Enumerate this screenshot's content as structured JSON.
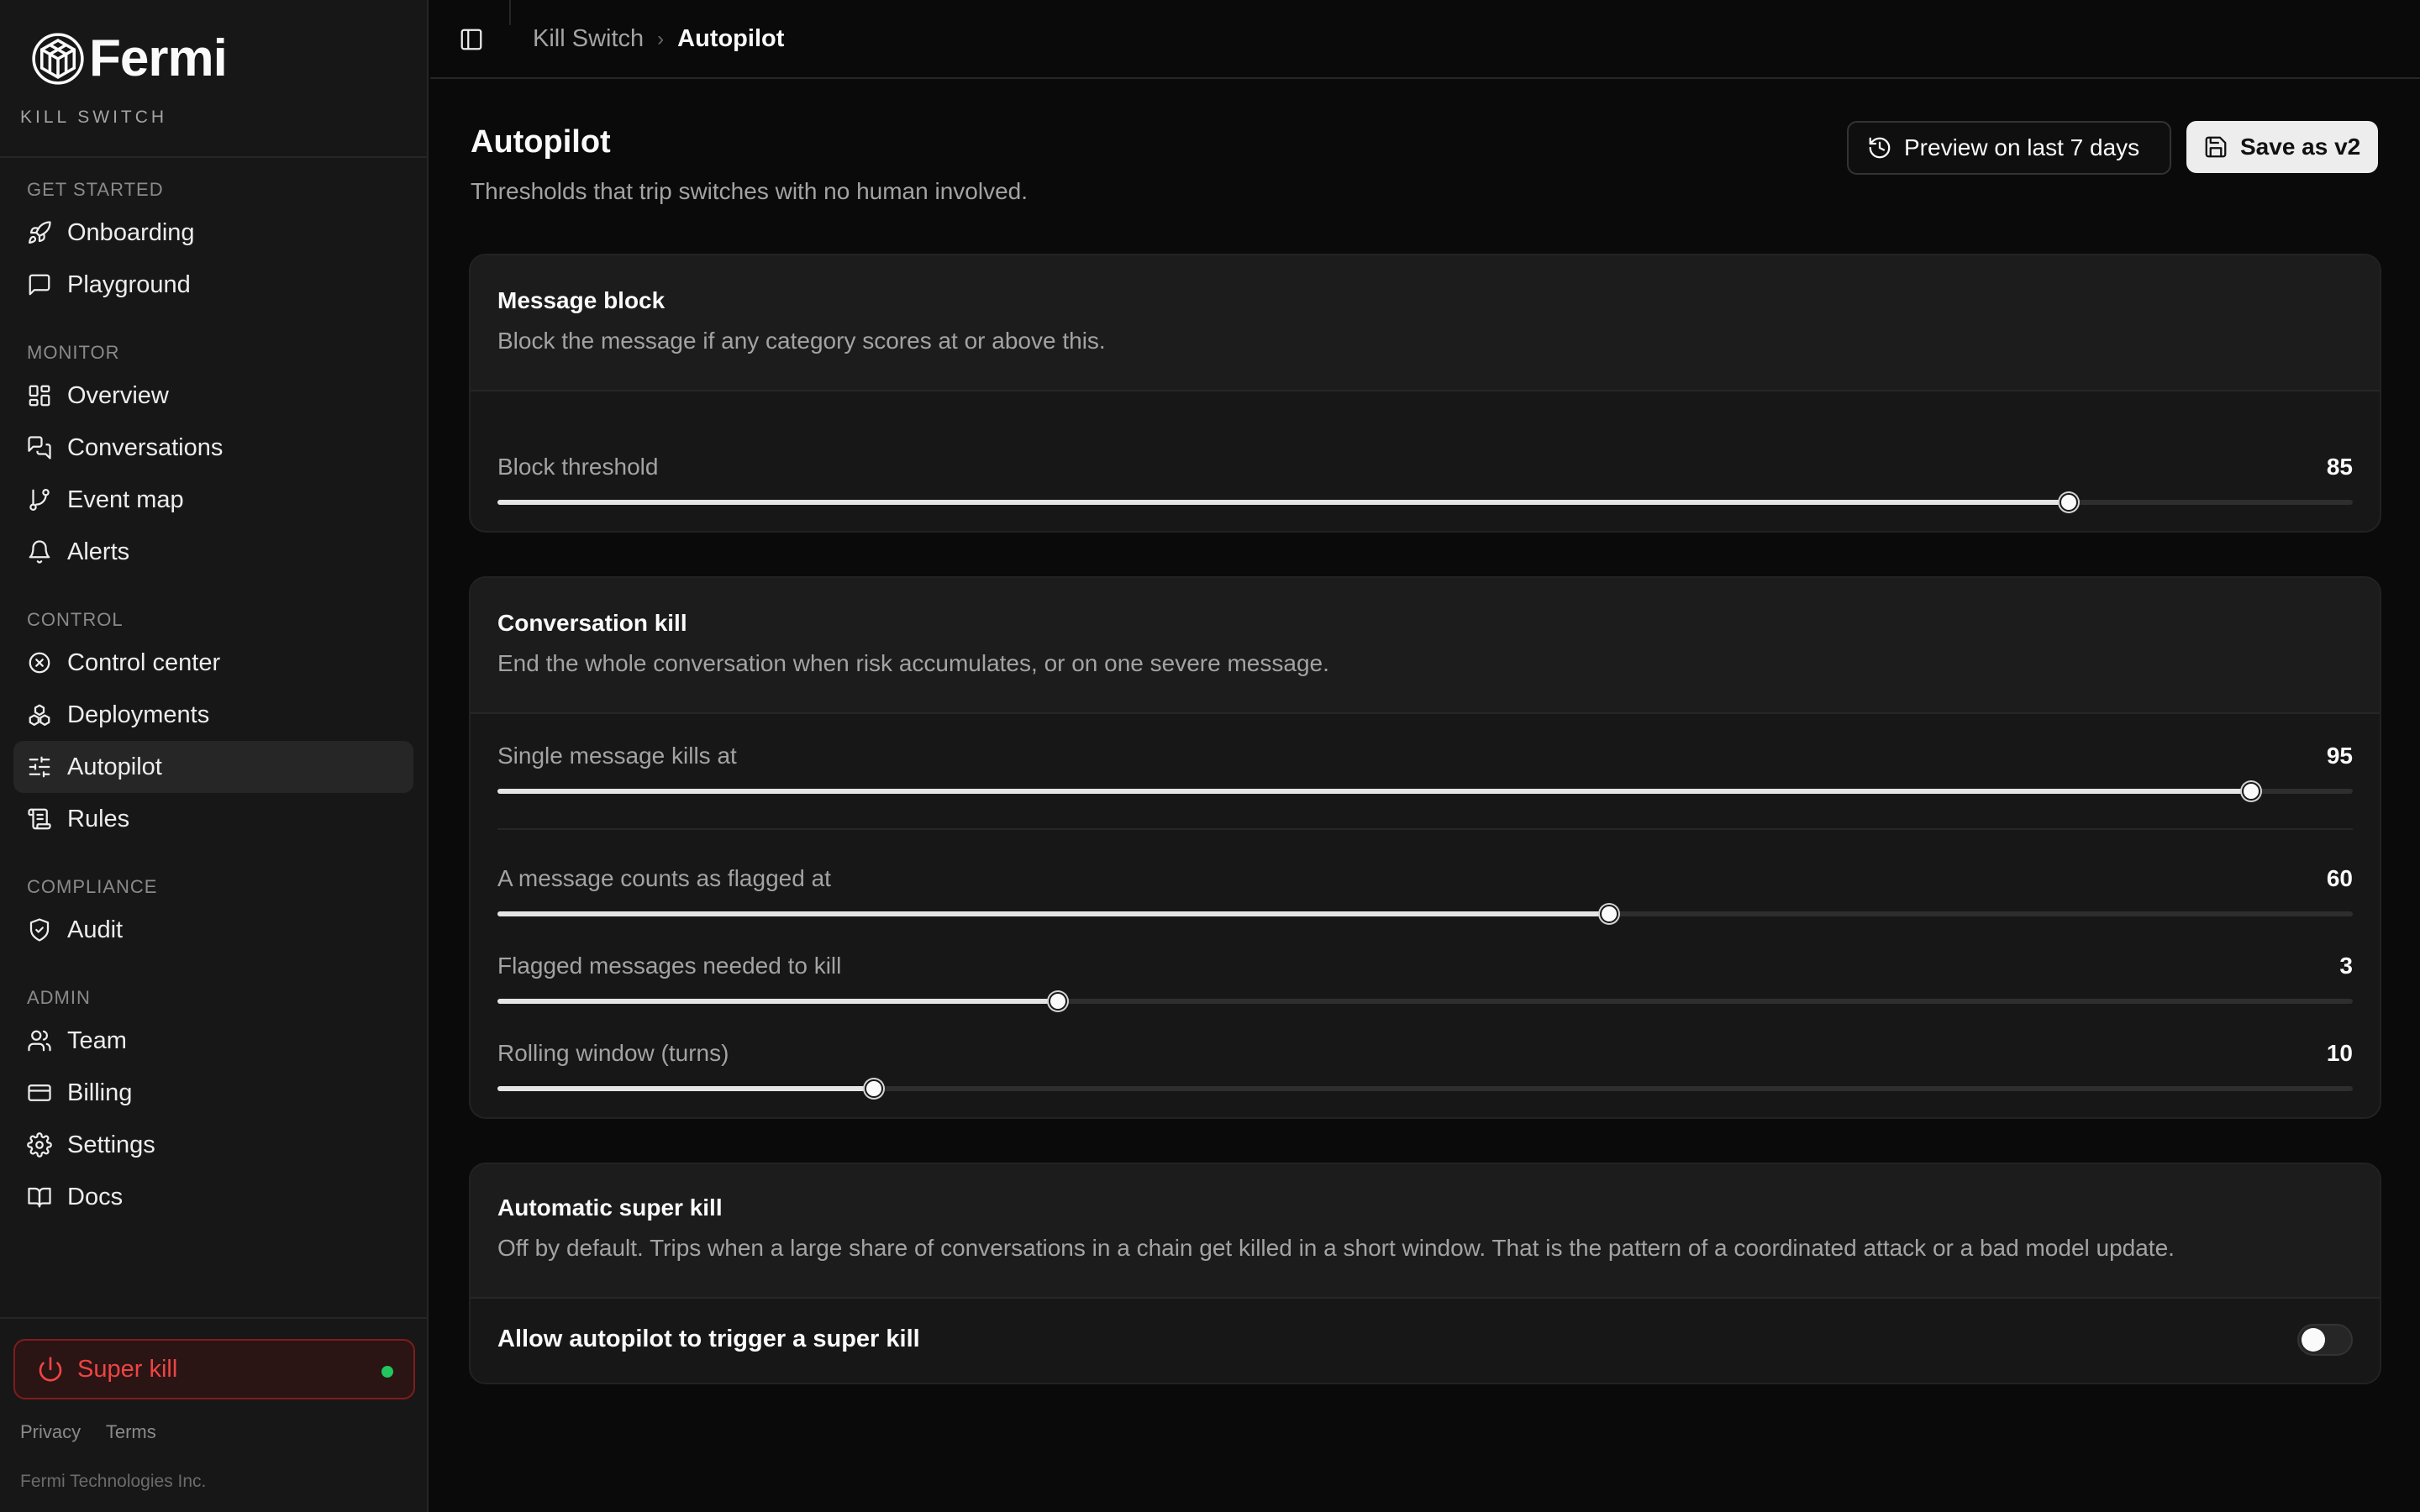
{
  "brand": {
    "name": "Fermi",
    "subtitle": "KILL SWITCH"
  },
  "sidebar": {
    "groups": [
      {
        "label": "GET STARTED",
        "items": [
          {
            "label": "Onboarding",
            "icon": "rocket-icon"
          },
          {
            "label": "Playground",
            "icon": "message-square-icon"
          }
        ]
      },
      {
        "label": "MONITOR",
        "items": [
          {
            "label": "Overview",
            "icon": "dashboard-grid-icon"
          },
          {
            "label": "Conversations",
            "icon": "messages-icon"
          },
          {
            "label": "Event map",
            "icon": "git-branch-icon"
          },
          {
            "label": "Alerts",
            "icon": "bell-icon"
          }
        ]
      },
      {
        "label": "CONTROL",
        "items": [
          {
            "label": "Control center",
            "icon": "circle-x-icon"
          },
          {
            "label": "Deployments",
            "icon": "boxes-icon"
          },
          {
            "label": "Autopilot",
            "icon": "sliders-icon",
            "active": true
          },
          {
            "label": "Rules",
            "icon": "scroll-icon"
          }
        ]
      },
      {
        "label": "COMPLIANCE",
        "items": [
          {
            "label": "Audit",
            "icon": "shield-check-icon"
          }
        ]
      },
      {
        "label": "ADMIN",
        "items": [
          {
            "label": "Team",
            "icon": "users-icon"
          },
          {
            "label": "Billing",
            "icon": "credit-card-icon"
          },
          {
            "label": "Settings",
            "icon": "gear-icon"
          },
          {
            "label": "Docs",
            "icon": "book-open-icon"
          }
        ]
      }
    ],
    "super_kill": {
      "label": "Super kill",
      "status_color": "#22c55e"
    },
    "footer": {
      "privacy": "Privacy",
      "terms": "Terms",
      "copyright": "Fermi Technologies Inc."
    }
  },
  "header": {
    "breadcrumb_root": "Kill Switch",
    "breadcrumb_current": "Autopilot"
  },
  "page": {
    "title": "Autopilot",
    "subtitle": "Thresholds that trip switches with no human involved.",
    "preview_button": "Preview on last 7 days",
    "save_button": "Save as v2"
  },
  "cards": {
    "message_block": {
      "title": "Message block",
      "description": "Block the message if any category scores at or above this.",
      "block_threshold": {
        "label": "Block threshold",
        "value": "85",
        "fraction": 0.847
      }
    },
    "conversation_kill": {
      "title": "Conversation kill",
      "description": "End the whole conversation when risk accumulates, or on one severe message.",
      "single_message": {
        "label": "Single message kills at",
        "value": "95",
        "fraction": 0.945
      },
      "flagged_at": {
        "label": "A message counts as flagged at",
        "value": "60",
        "fraction": 0.599
      },
      "flagged_needed": {
        "label": "Flagged messages needed to kill",
        "value": "3",
        "fraction": 0.302
      },
      "rolling_window": {
        "label": "Rolling window (turns)",
        "value": "10",
        "fraction": 0.203
      }
    },
    "super_kill": {
      "title": "Automatic super kill",
      "description": "Off by default. Trips when a large share of conversations in a chain get killed in a short window. That is the pattern of a coordinated attack or a bad model update.",
      "toggle_label": "Allow autopilot to trigger a super kill",
      "enabled": false
    }
  },
  "colors": {
    "accent_danger": "#ef4444",
    "status_online": "#22c55e",
    "background": "#0a0a0a",
    "panel": "#171717"
  }
}
